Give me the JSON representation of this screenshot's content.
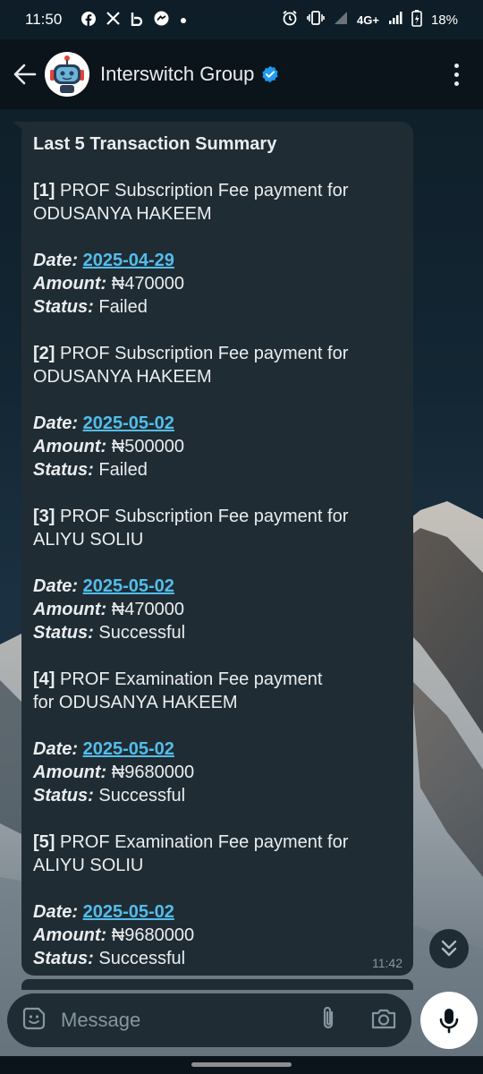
{
  "status_bar": {
    "time": "11:50",
    "left_icons": [
      "facebook-icon",
      "x-icon",
      "b-icon",
      "messenger-icon"
    ],
    "network": "4G+",
    "battery": "18%"
  },
  "header": {
    "title": "Interswitch Group",
    "verified": true
  },
  "message": {
    "heading": "Last 5 Transaction Summary",
    "transactions": [
      {
        "index": "[1]",
        "description": "PROF Subscription Fee payment for ODUSANYA HAKEEM",
        "date_label": "Date:",
        "date": "2025-04-29",
        "amount_label": "Amount:",
        "amount": "₦470000",
        "status_label": "Status:",
        "status": "Failed"
      },
      {
        "index": "[2]",
        "description": "PROF Subscription Fee payment for ODUSANYA HAKEEM",
        "date_label": "Date:",
        "date": "2025-05-02",
        "amount_label": "Amount:",
        "amount": "₦500000",
        "status_label": "Status:",
        "status": "Failed"
      },
      {
        "index": "[3]",
        "description": "PROF Subscription Fee payment for ALIYU SOLIU",
        "date_label": "Date:",
        "date": "2025-05-02",
        "amount_label": "Amount:",
        "amount": "₦470000",
        "status_label": "Status:",
        "status": "Successful"
      },
      {
        "index": "[4]",
        "description": "PROF Examination Fee payment for ODUSANYA HAKEEM",
        "date_label": "Date:",
        "date": "2025-05-02",
        "amount_label": "Amount:",
        "amount": "₦9680000",
        "status_label": "Status:",
        "status": "Successful"
      },
      {
        "index": "[5]",
        "description": "PROF Examination Fee payment  for ALIYU SOLIU",
        "date_label": "Date:",
        "date": "2025-05-02",
        "amount_label": "Amount:",
        "amount": "₦9680000",
        "status_label": "Status:",
        "status": "Successful"
      }
    ],
    "time": "11:42"
  },
  "composer": {
    "placeholder": "Message"
  },
  "colors": {
    "bubble": "#202c33",
    "link": "#53bdeb",
    "header_bg": "#0b141a",
    "verified": "#1d9bf0"
  }
}
